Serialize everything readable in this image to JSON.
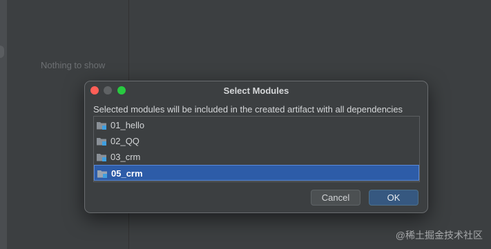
{
  "background": {
    "empty_text": "Nothing to show"
  },
  "dialog": {
    "title": "Select Modules",
    "description": "Selected modules will be included in the created artifact with all dependencies",
    "modules": [
      {
        "label": "01_hello",
        "selected": false
      },
      {
        "label": "02_QQ",
        "selected": false
      },
      {
        "label": "03_crm",
        "selected": false
      },
      {
        "label": "05_crm",
        "selected": true
      }
    ],
    "cancel_label": "Cancel",
    "ok_label": "OK"
  },
  "watermark": "@稀土掘金技术社区",
  "colors": {
    "selection": "#2d5ca8",
    "ok_button": "#365880",
    "close_light": "#fe5f57",
    "zoom_light": "#28c940",
    "module_badge": "#3f9fe0"
  },
  "icons": [
    "module-folder-icon"
  ]
}
